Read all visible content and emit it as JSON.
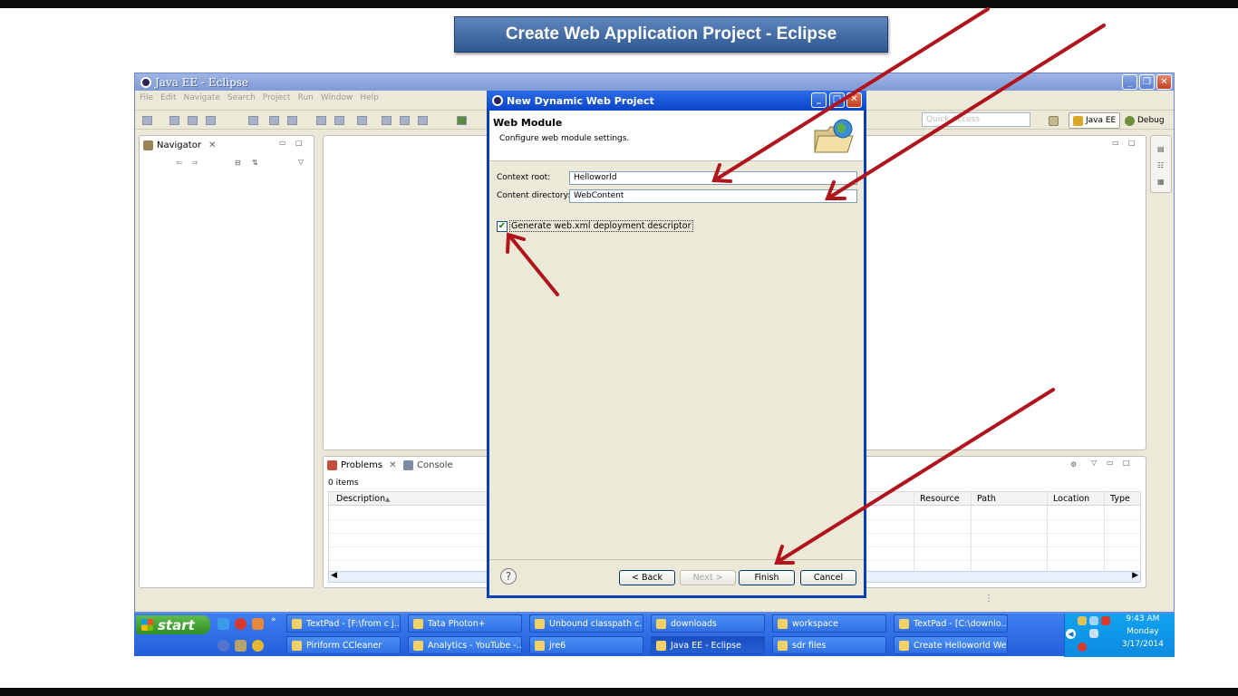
{
  "slide_title": "Create Web Application Project - Eclipse",
  "eclipse": {
    "window_title": "Java EE - Eclipse",
    "menu": [
      "File",
      "Edit",
      "Navigate",
      "Search",
      "Project",
      "Run",
      "Window",
      "Help"
    ],
    "quick_access_placeholder": "Quick Access",
    "perspectives": [
      "Java EE",
      "Debug"
    ],
    "navigator_tab": "Navigator",
    "problems_tab": "Problems",
    "console_tab": "Console",
    "problems_count": "0 items",
    "columns": [
      "Description",
      "Resource",
      "Path",
      "Location",
      "Type"
    ]
  },
  "dialog": {
    "title": "New Dynamic Web Project",
    "header": "Web Module",
    "subheader": "Configure web module settings.",
    "context_root_label": "Context root:",
    "context_root_value": "Helloworld",
    "content_dir_label": "Content directory:",
    "content_dir_value": "WebContent",
    "generate_descriptor_label": "Generate web.xml deployment descriptor",
    "generate_descriptor_checked": true,
    "buttons": {
      "help": "?",
      "back": "< Back",
      "next": "Next >",
      "finish": "Finish",
      "cancel": "Cancel"
    }
  },
  "taskbar": {
    "start": "start",
    "row1": [
      "TextPad - [F:\\from c j...",
      "Tata Photon+",
      "Unbound classpath c...",
      "downloads",
      "workspace",
      "TextPad - [C:\\downlo..."
    ],
    "row2": [
      "Piriform CCleaner",
      "Analytics - YouTube -...",
      "jre6",
      "Java EE - Eclipse",
      "sdr files",
      "Create Helloworld We..."
    ],
    "clock": {
      "time": "9:43 AM",
      "day": "Monday",
      "date": "3/17/2014"
    }
  },
  "colors": {
    "arrow": "#b0141c",
    "xp_blue": "#245edb",
    "dialog_border": "#0a3fb0"
  }
}
